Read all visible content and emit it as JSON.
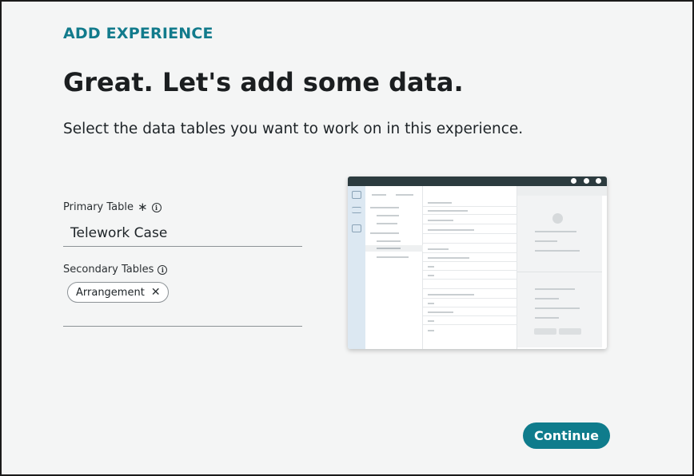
{
  "header": {
    "eyebrow": "ADD EXPERIENCE",
    "title": "Great. Let's add some data.",
    "subtitle": "Select the data tables you want to work on in this experience."
  },
  "form": {
    "primary_table": {
      "label": "Primary Table",
      "required_marker": "∗",
      "info_icon": "info-icon",
      "value": "Telework Case"
    },
    "secondary_tables": {
      "label": "Secondary Tables",
      "info_icon": "info-icon",
      "chips": [
        {
          "label": "Arrangement",
          "remove_icon": "close-icon"
        }
      ]
    }
  },
  "preview": {
    "top_bar_icons": [
      "search-icon",
      "bell-icon",
      "user-icon"
    ],
    "rail_icons": [
      "home-icon",
      "menu-icon",
      "inbox-icon"
    ]
  },
  "actions": {
    "continue_label": "Continue"
  },
  "colors": {
    "accent": "#0f7c8c",
    "background": "#f4f5f5"
  }
}
